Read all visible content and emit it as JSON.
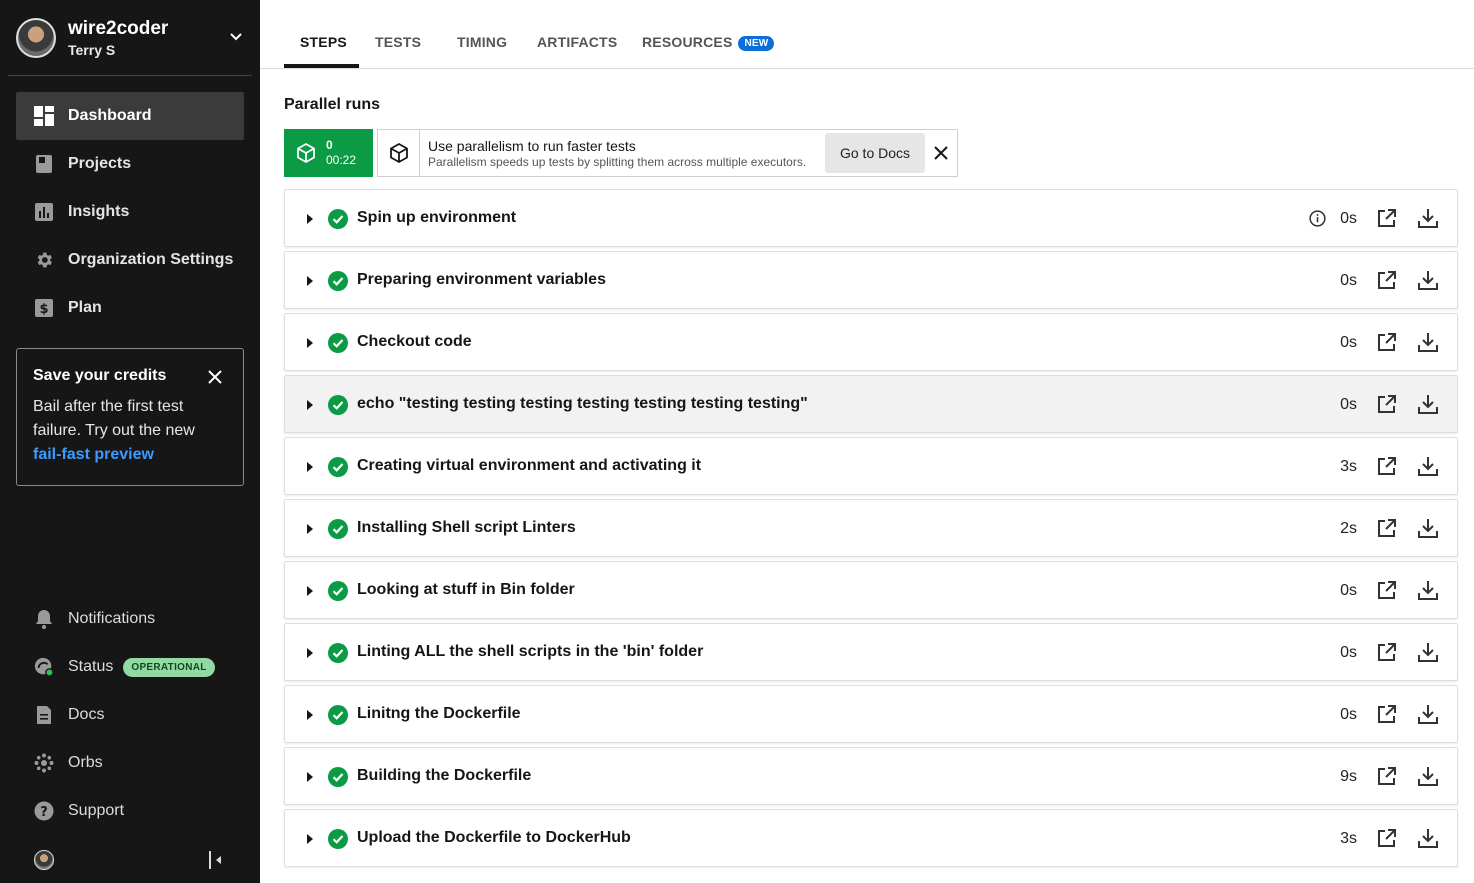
{
  "sidebar": {
    "org_name": "wire2coder",
    "user_name": "Terry S",
    "nav": [
      {
        "label": "Dashboard",
        "icon": "dashboard-icon",
        "active": true
      },
      {
        "label": "Projects",
        "icon": "projects-icon"
      },
      {
        "label": "Insights",
        "icon": "insights-icon"
      },
      {
        "label": "Organization Settings",
        "icon": "gear-icon"
      },
      {
        "label": "Plan",
        "icon": "dollar-icon"
      }
    ],
    "promo": {
      "title": "Save your credits",
      "body": "Bail after the first test failure. Try out the new",
      "link": "fail-fast preview"
    },
    "bottom_nav": [
      {
        "label": "Notifications",
        "icon": "bell-icon"
      },
      {
        "label": "Status",
        "icon": "status-icon",
        "badge": "OPERATIONAL"
      },
      {
        "label": "Docs",
        "icon": "doc-icon"
      },
      {
        "label": "Orbs",
        "icon": "orbs-icon"
      },
      {
        "label": "Support",
        "icon": "help-icon"
      }
    ]
  },
  "tabs": [
    {
      "label": "STEPS",
      "active": true
    },
    {
      "label": "TESTS"
    },
    {
      "label": "TIMING"
    },
    {
      "label": "ARTIFACTS"
    },
    {
      "label": "RESOURCES",
      "badge": "NEW"
    }
  ],
  "parallel": {
    "title": "Parallel runs",
    "index": "0",
    "time": "00:22",
    "banner_title": "Use parallelism to run faster tests",
    "banner_sub": "Parallelism speeds up tests by splitting them across multiple executors.",
    "docs_button": "Go to Docs"
  },
  "steps": [
    {
      "name": "Spin up environment",
      "duration": "0s",
      "info": true
    },
    {
      "name": "Preparing environment variables",
      "duration": "0s"
    },
    {
      "name": "Checkout code",
      "duration": "0s"
    },
    {
      "name": "echo \"testing testing testing testing testing testing testing\"",
      "duration": "0s",
      "highlight": true
    },
    {
      "name": "Creating virtual environment and activating it",
      "duration": "3s"
    },
    {
      "name": "Installing Shell script Linters",
      "duration": "2s"
    },
    {
      "name": "Looking at stuff in Bin folder",
      "duration": "0s"
    },
    {
      "name": "Linting ALL the shell scripts in the 'bin' folder",
      "duration": "0s"
    },
    {
      "name": "Linitng the Dockerfile",
      "duration": "0s"
    },
    {
      "name": "Building the Dockerfile",
      "duration": "9s"
    },
    {
      "name": "Upload the Dockerfile to DockerHub",
      "duration": "3s"
    }
  ],
  "colors": {
    "success": "#0c9b45",
    "sidebar_bg": "#161616",
    "accent": "#0a6edb",
    "link": "#3b9cff"
  }
}
